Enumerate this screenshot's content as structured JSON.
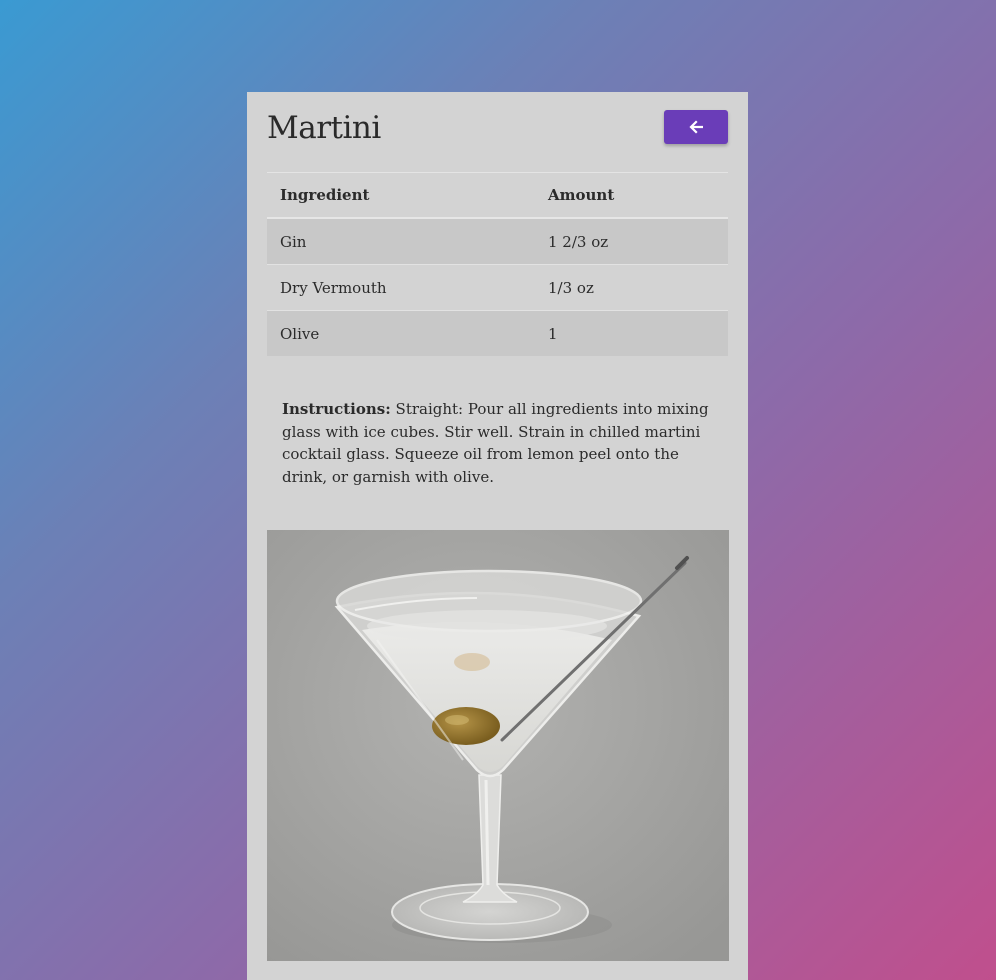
{
  "drink": {
    "title": "Martini",
    "back_icon": "arrow-left-icon"
  },
  "ingredients_table": {
    "headers": {
      "ingredient": "Ingredient",
      "amount": "Amount"
    },
    "rows": [
      {
        "ingredient": "Gin",
        "amount": "1 2/3 oz"
      },
      {
        "ingredient": "Dry Vermouth",
        "amount": "1/3 oz"
      },
      {
        "ingredient": "Olive",
        "amount": "1"
      }
    ]
  },
  "instructions": {
    "label": "Instructions:",
    "text": "Straight: Pour all ingredients into mixing glass with ice cubes. Stir well. Strain in chilled martini cocktail glass. Squeeze oil from lemon peel onto the drink, or garnish with olive."
  },
  "colors": {
    "accent": "#6a3db8",
    "card": "#d3d3d3",
    "row_stripe": "#c8c8c8"
  }
}
